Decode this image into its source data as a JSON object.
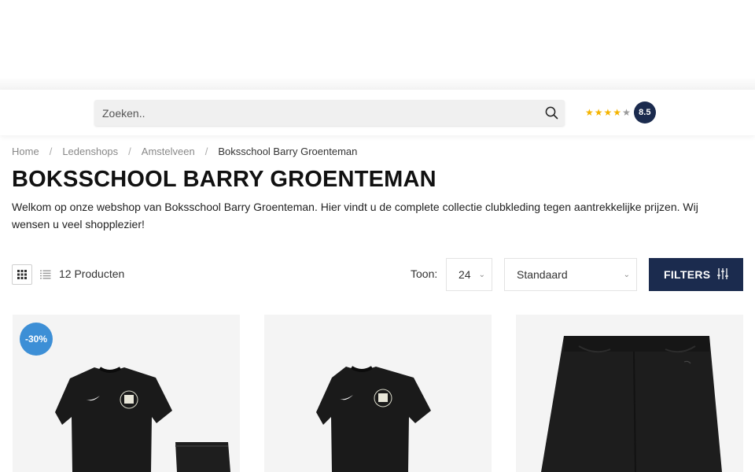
{
  "search": {
    "placeholder": "Zoeken.."
  },
  "rating": {
    "score": "8.5",
    "stars_filled": 4,
    "stars_total": 5
  },
  "breadcrumb": [
    {
      "label": "Home"
    },
    {
      "label": "Ledenshops"
    },
    {
      "label": "Amstelveen"
    },
    {
      "label": "Boksschool Barry Groenteman"
    }
  ],
  "page": {
    "title": "BOKSSCHOOL BARRY GROENTEMAN",
    "intro": "Welkom op onze webshop van Boksschool Barry Groenteman. Hier vindt u de complete collectie clubkleding tegen aantrekkelijke prijzen. Wij wensen u veel shopplezier!"
  },
  "toolbar": {
    "product_count": "12 Producten",
    "show_label": "Toon:",
    "show_value": "24",
    "sort_value": "Standaard",
    "filters_label": "FILTERS"
  },
  "products": [
    {
      "discount_badge": "-30%",
      "icon": "black-shirt-and-shorts-set"
    },
    {
      "icon": "black-shirt"
    },
    {
      "icon": "black-shorts"
    }
  ],
  "colors": {
    "navy": "#1b2b4e",
    "discount_blue": "#3d8fd6",
    "star_yellow": "#f5b400"
  }
}
